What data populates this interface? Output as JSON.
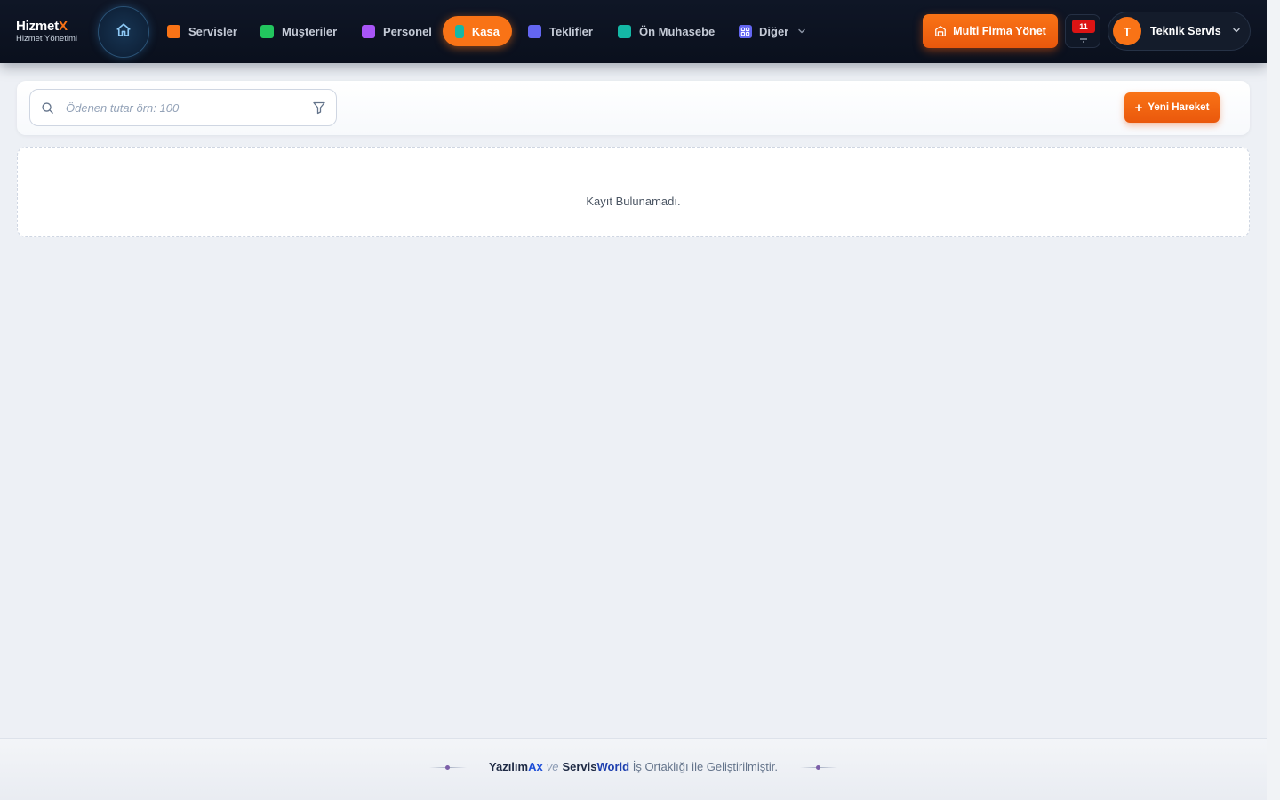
{
  "brand": {
    "name_main": "Hizmet",
    "name_accent": "X",
    "subtitle": "Hizmet Yönetimi"
  },
  "nav": {
    "items": [
      {
        "label": "Servisler",
        "color": "#f97316"
      },
      {
        "label": "Müşteriler",
        "color": "#22c55e"
      },
      {
        "label": "Personel",
        "color": "#a855f7"
      },
      {
        "label": "Kasa",
        "color": "#14b8a6",
        "active": true
      },
      {
        "label": "Teklifler",
        "color": "#6366f1"
      },
      {
        "label": "Ön Muhasebe",
        "color": "#14b8a6"
      },
      {
        "label": "Diğer",
        "icon": "grid-icon",
        "color": "#6366f1"
      }
    ]
  },
  "header": {
    "multi_firm_label": "Multi Firma Yönet",
    "notification_count": "11",
    "user": {
      "initial": "T",
      "name": "Teknik Servis"
    }
  },
  "toolbar": {
    "search_placeholder": "Ödenen tutar örn: 100",
    "new_button_label": "Yeni Hareket"
  },
  "empty_state": {
    "message": "Kayıt Bulunamadı."
  },
  "footer": {
    "brand1_main": "Yazılım",
    "brand1_accent": "Ax",
    "connector": "ve",
    "brand2_main": "Servis",
    "brand2_accent": "World",
    "suffix": "İş Ortaklığı ile Geliştirilmiştir."
  },
  "colors": {
    "accent": "#f97316",
    "header_bg": "#0c1220",
    "page_bg": "#edf0f5"
  }
}
